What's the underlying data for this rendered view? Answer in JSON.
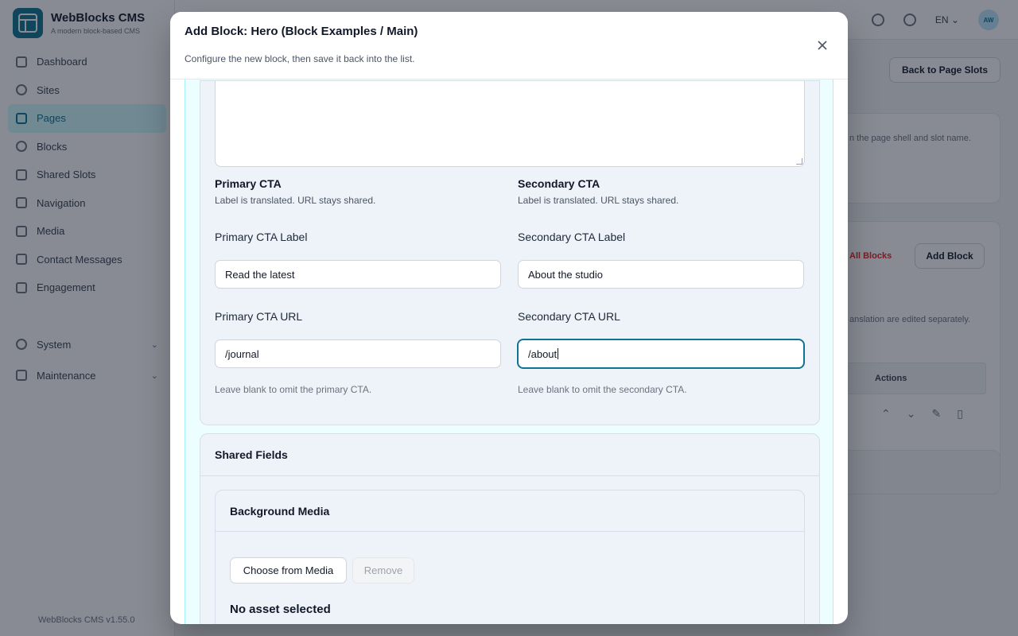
{
  "app": {
    "brand_name": "WebBlocks CMS",
    "brand_sub": "A modern block-based CMS",
    "version": "WebBlocks CMS v1.55.0",
    "nav": [
      {
        "label": "Dashboard",
        "icon": "dashboard-icon"
      },
      {
        "label": "Sites",
        "icon": "globe-icon"
      },
      {
        "label": "Pages",
        "icon": "page-icon",
        "active": true
      },
      {
        "label": "Blocks",
        "icon": "blocks-icon"
      },
      {
        "label": "Shared Slots",
        "icon": "shared-slots-icon"
      },
      {
        "label": "Navigation",
        "icon": "navigation-icon"
      },
      {
        "label": "Media",
        "icon": "media-icon"
      },
      {
        "label": "Contact Messages",
        "icon": "mail-icon"
      },
      {
        "label": "Engagement",
        "icon": "star-icon"
      }
    ],
    "groups": [
      {
        "label": "System",
        "icon": "gear-icon"
      },
      {
        "label": "Maintenance",
        "icon": "file-icon"
      }
    ],
    "lang": "EN",
    "avatar": "AW",
    "back_button": "Back to Page Slots",
    "bg_hint_1": "n the page shell and slot name.",
    "bg_all_blocks": "All Blocks",
    "bg_add_block": "Add Block",
    "bg_hint_2": "anslation are edited separately.",
    "bg_actions": "Actions"
  },
  "modal": {
    "title": "Add Block: Hero (Block Examples / Main)",
    "subtitle": "Configure the new block, then save it back into the list.",
    "primary": {
      "title": "Primary CTA",
      "hint": "Label is translated. URL stays shared.",
      "label_label": "Primary CTA Label",
      "label_value": "Read the latest",
      "url_label": "Primary CTA URL",
      "url_value": "/journal",
      "blank_hint": "Leave blank to omit the primary CTA."
    },
    "secondary": {
      "title": "Secondary CTA",
      "hint": "Label is translated. URL stays shared.",
      "label_label": "Secondary CTA Label",
      "label_value": "About the studio",
      "url_label": "Secondary CTA URL",
      "url_value": "/about",
      "blank_hint": "Leave blank to omit the secondary CTA."
    },
    "shared": {
      "title": "Shared Fields",
      "media_title": "Background Media",
      "choose_label": "Choose from Media",
      "remove_label": "Remove",
      "no_asset": "No asset selected"
    }
  },
  "colors": {
    "accent": "#0e7490",
    "panel": "#ecfeff",
    "card": "#eef2f9"
  }
}
